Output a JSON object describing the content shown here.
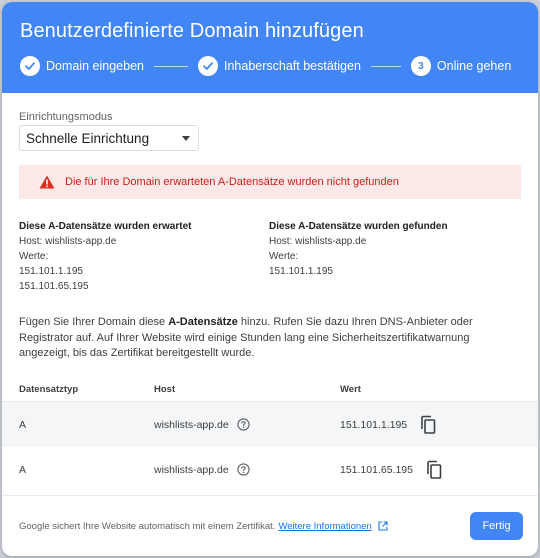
{
  "dialog": {
    "title": "Benutzerdefinierte Domain hinzufügen"
  },
  "steps": [
    {
      "label": "Domain eingeben",
      "state": "done"
    },
    {
      "label": "Inhaberschaft bestätigen",
      "state": "done"
    },
    {
      "label": "Online gehen",
      "state": "current",
      "number": "3"
    }
  ],
  "mode": {
    "label": "Einrichtungsmodus",
    "selected": "Schnelle Einrichtung"
  },
  "alert": {
    "text": "Die für Ihre Domain erwarteten A-Datensätze wurden nicht gefunden"
  },
  "expected": {
    "heading": "Diese A-Datensätze wurden erwartet",
    "host": "Host: wishlists-app.de",
    "values_label": "Werte:",
    "values": [
      "151.101.1.195",
      "151.101.65.195"
    ]
  },
  "found": {
    "heading": "Diese A-Datensätze wurden gefunden",
    "host": "Host: wishlists-app.de",
    "values_label": "Werte:",
    "values": [
      "151.101.1.195"
    ]
  },
  "info": {
    "prefix": "Fügen Sie Ihrer Domain diese ",
    "bold": "A-Datensätze",
    "suffix": " hinzu. Rufen Sie dazu Ihren DNS-Anbieter oder Registrator auf. Auf Ihrer Website wird einige Stunden lang eine Sicherheitszertifikatwarnung angezeigt, bis das Zertifikat bereitgestellt wurde."
  },
  "table": {
    "headers": {
      "type": "Datensatztyp",
      "host": "Host",
      "value": "Wert"
    },
    "rows": [
      {
        "type": "A",
        "host": "wishlists-app.de",
        "value": "151.101.1.195"
      },
      {
        "type": "A",
        "host": "wishlists-app.de",
        "value": "151.101.65.195"
      }
    ]
  },
  "footer": {
    "text": "Google sichert Ihre Website automatisch mit einem Zertifikat.",
    "link": "Weitere Informationen",
    "done_button": "Fertig"
  },
  "colors": {
    "header": "#4285f4",
    "alert_bg": "#fce8e6",
    "alert_text": "#c5221f",
    "link": "#1a73e8"
  }
}
